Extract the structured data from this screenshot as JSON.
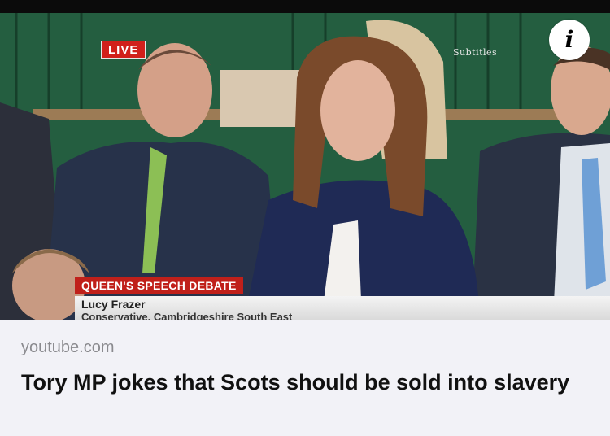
{
  "video": {
    "live_label": "LIVE",
    "subtitles_label": "Subtitles",
    "caption_title": "QUEEN'S SPEECH DEBATE",
    "speaker_name": "Lucy Frazer",
    "speaker_detail": "Conservative, Cambridgeshire South East",
    "info_icon": "info-icon"
  },
  "link": {
    "domain": "youtube.com",
    "title": "Tory MP jokes that Scots should be sold into slavery"
  },
  "colors": {
    "live_red": "#d1201b",
    "caption_red": "#c0201a",
    "bench_green": "#1f5a3b",
    "domain_gray": "#8a8a8e"
  }
}
